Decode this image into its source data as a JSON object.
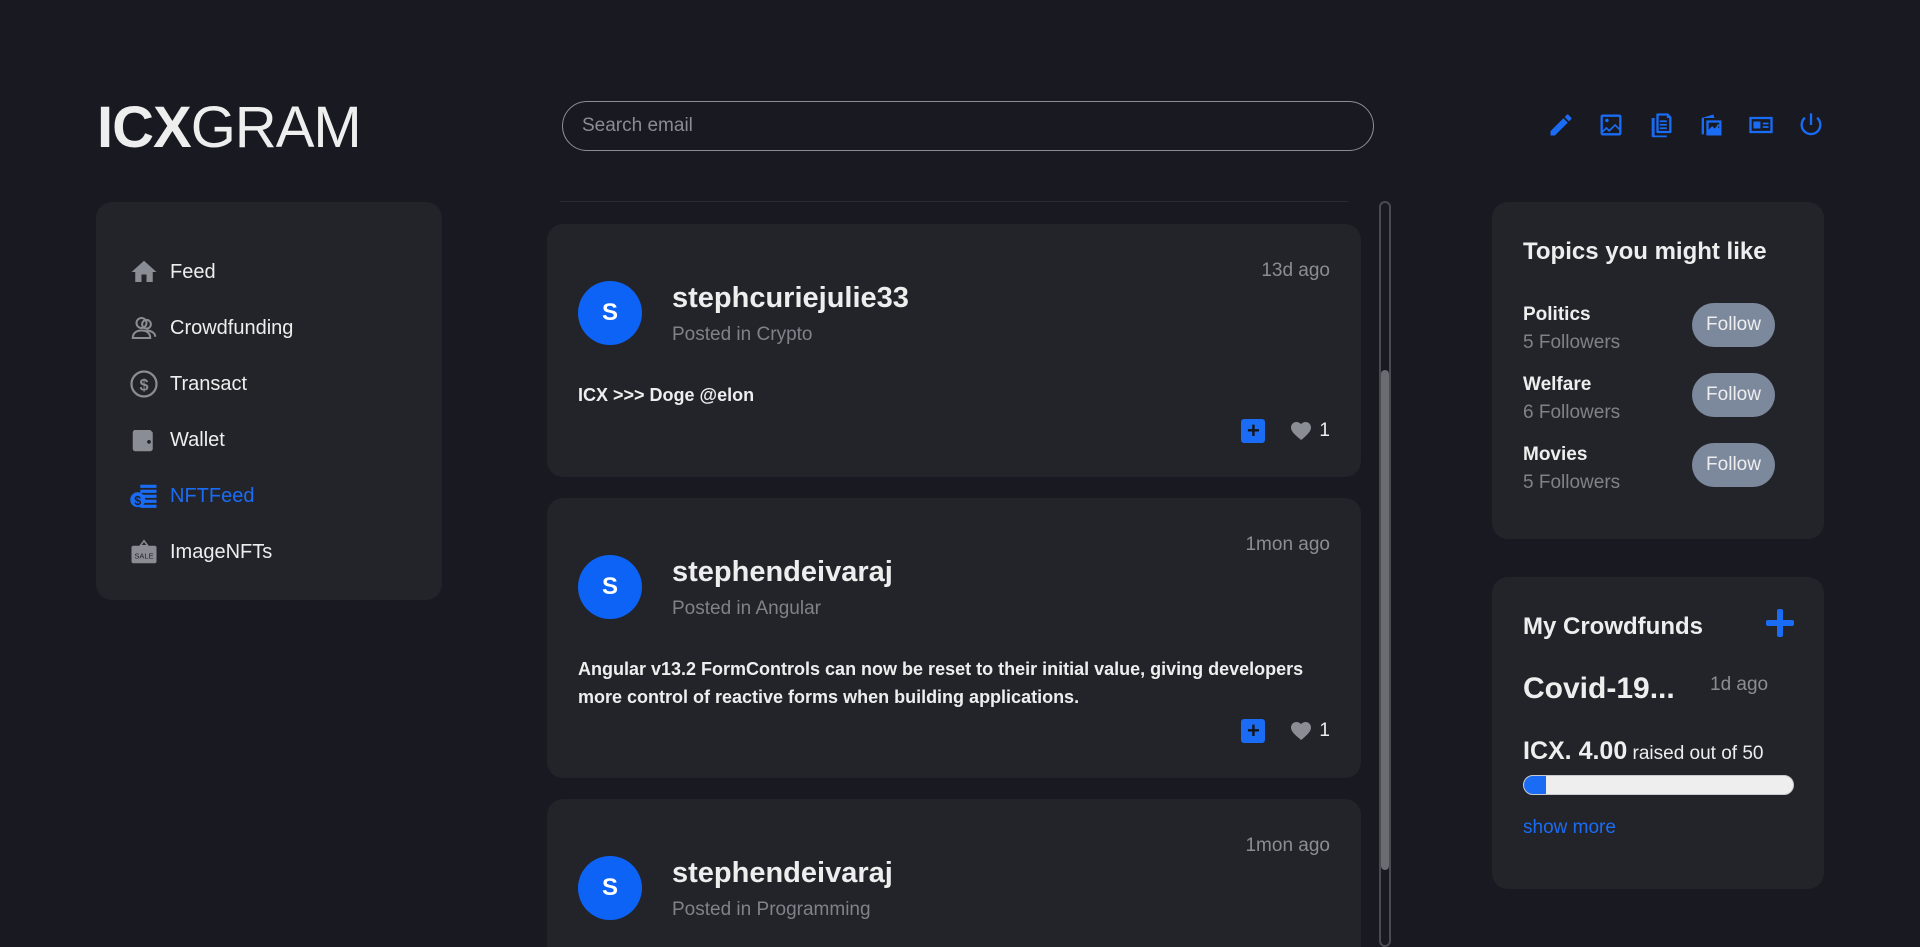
{
  "logo": {
    "bold": "ICX",
    "light": "GRAM"
  },
  "search": {
    "placeholder": "Search email"
  },
  "toolbar_icons": [
    "pencil-icon",
    "image-icon",
    "documents-icon",
    "image-gallery-icon",
    "id-card-icon",
    "power-icon"
  ],
  "nav": {
    "items": [
      {
        "label": "Feed",
        "icon": "home-icon"
      },
      {
        "label": "Crowdfunding",
        "icon": "users-icon"
      },
      {
        "label": "Transact",
        "icon": "dollar-circle-icon"
      },
      {
        "label": "Wallet",
        "icon": "wallet-icon"
      },
      {
        "label": "NFTFeed",
        "icon": "nft-feed-icon",
        "active": true
      },
      {
        "label": "ImageNFTs",
        "icon": "sale-tag-icon"
      }
    ]
  },
  "posts": [
    {
      "avatar": "S",
      "username": "stephcuriejulie33",
      "posted_in_prefix": "Posted in",
      "category": "Crypto",
      "time": "13d ago",
      "body": "ICX >>> Doge @elon",
      "likes": "1",
      "add_symbol": "+"
    },
    {
      "avatar": "S",
      "username": "stephendeivaraj",
      "posted_in_prefix": "Posted in",
      "category": "Angular",
      "time": "1mon ago",
      "body": "Angular v13.2 FormControls can now be reset to their initial value, giving developers more control of reactive forms when building applications.",
      "likes": "1",
      "add_symbol": "+"
    },
    {
      "avatar": "S",
      "username": "stephendeivaraj",
      "posted_in_prefix": "Posted in",
      "category": "Programming",
      "time": "1mon ago"
    }
  ],
  "topics": {
    "title": "Topics you might like",
    "items": [
      {
        "name": "Politics",
        "followers": "5 Followers",
        "button": "Follow"
      },
      {
        "name": "Welfare",
        "followers": "6 Followers",
        "button": "Follow"
      },
      {
        "name": "Movies",
        "followers": "5 Followers",
        "button": "Follow"
      }
    ]
  },
  "crowdfunds": {
    "title": "My Crowdfunds",
    "name": "Covid-19...",
    "time": "1d ago",
    "raised_amount": "ICX. 4.00",
    "raised_suffix": "raised out of 50",
    "progress_fraction": 0.08,
    "show_more": "show more"
  },
  "colors": {
    "accent": "#1a6cf5",
    "background": "#181921",
    "card": "#232429",
    "follow_button": "#7c889c"
  }
}
